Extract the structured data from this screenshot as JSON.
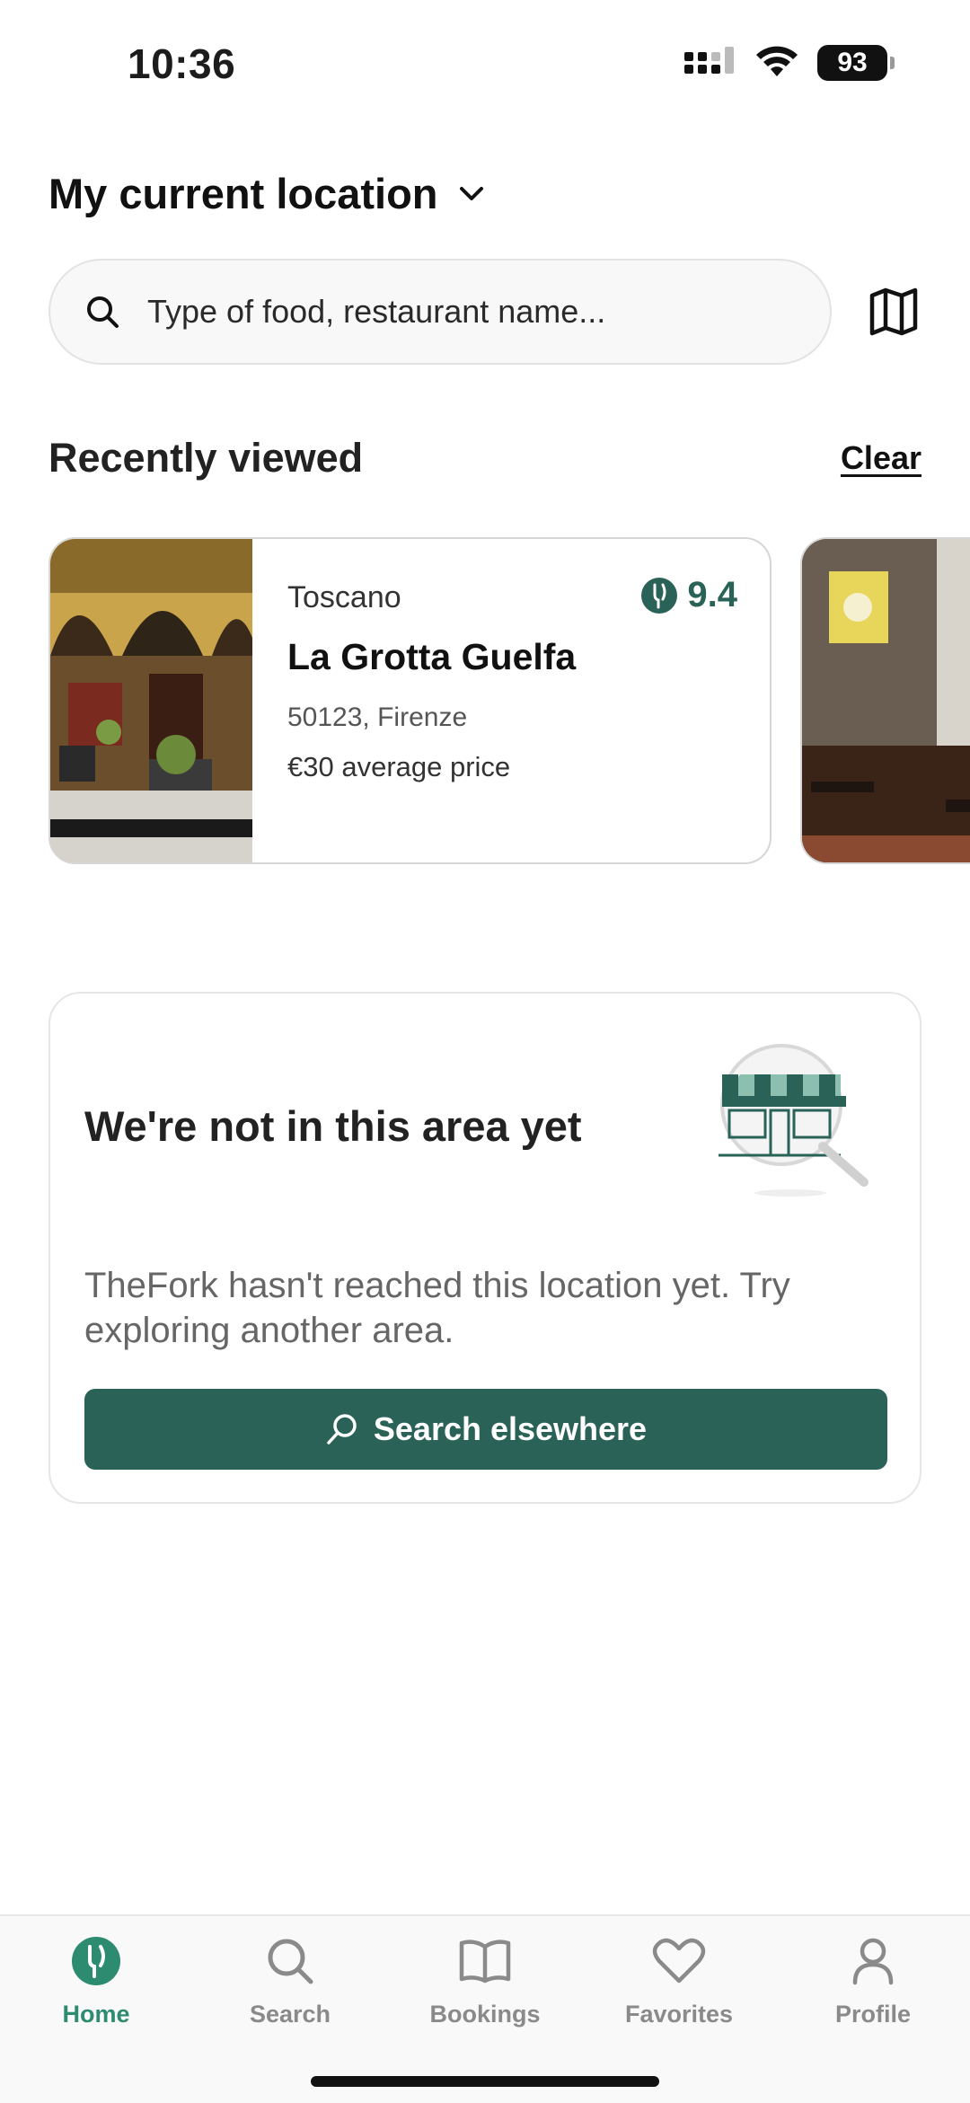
{
  "status_bar": {
    "time": "10:36",
    "battery": "93"
  },
  "location": {
    "title": "My current location"
  },
  "search": {
    "placeholder": "Type of food, restaurant name..."
  },
  "recently_viewed": {
    "title": "Recently viewed",
    "clear_label": "Clear",
    "items": [
      {
        "cuisine": "Toscano",
        "rating": "9.4",
        "name": "La Grotta Guelfa",
        "address": "50123, Firenze",
        "price": "€30 average price"
      }
    ]
  },
  "area_notice": {
    "title": "We're not in this area yet",
    "description": "TheFork hasn't reached this location yet. Try exploring another area.",
    "button_label": "Search elsewhere"
  },
  "bottom_nav": {
    "items": [
      {
        "label": "Home",
        "icon": "fork-logo-icon",
        "active": true
      },
      {
        "label": "Search",
        "icon": "search-icon",
        "active": false
      },
      {
        "label": "Bookings",
        "icon": "book-icon",
        "active": false
      },
      {
        "label": "Favorites",
        "icon": "heart-icon",
        "active": false
      },
      {
        "label": "Profile",
        "icon": "person-icon",
        "active": false
      }
    ]
  },
  "colors": {
    "brand": "#2a6257",
    "nav_active": "#2d8c6f",
    "nav_inactive": "#8a8a8a"
  }
}
